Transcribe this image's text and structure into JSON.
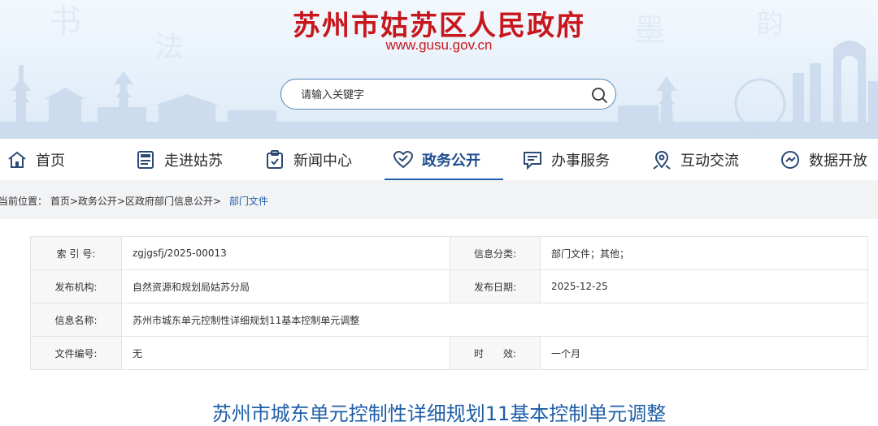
{
  "header": {
    "site_title": "苏州市姑苏区人民政府",
    "site_url": "www.gusu.gov.cn"
  },
  "search": {
    "placeholder": "请输入关键字",
    "icon": "search-icon"
  },
  "nav": {
    "items": [
      {
        "label": "首页",
        "icon": "home-icon",
        "active": false
      },
      {
        "label": "走进姑苏",
        "icon": "news-card-icon",
        "active": false
      },
      {
        "label": "新闻中心",
        "icon": "clipboard-icon",
        "active": false
      },
      {
        "label": "政务公开",
        "icon": "heart-icon",
        "active": true
      },
      {
        "label": "办事服务",
        "icon": "chat-icon",
        "active": false
      },
      {
        "label": "互动交流",
        "icon": "map-pin-icon",
        "active": false
      },
      {
        "label": "数据开放",
        "icon": "gauge-icon",
        "active": false
      }
    ]
  },
  "breadcrumb": {
    "prefix": "当前位置：",
    "items": [
      "首页",
      "政务公开",
      "区政府部门信息公开"
    ],
    "separator": ">",
    "current": "部门文件"
  },
  "info": {
    "index_label": "索 引 号:",
    "index_value": "zgjgsfj/2025-00013",
    "category_label": "信息分类:",
    "category_value": "部门文件；其他；",
    "publisher_label": "发布机构:",
    "publisher_value": "自然资源和规划局姑苏分局",
    "date_label": "发布日期:",
    "date_value": "2025-12-25",
    "name_label": "信息名称:",
    "name_value": "苏州市城东单元控制性详细规划11基本控制单元调整",
    "docno_label": "文件编号:",
    "docno_value": "无",
    "validity_label": "时　　效:",
    "validity_value": "一个月"
  },
  "document": {
    "title": "苏州市城东单元控制性详细规划11基本控制单元调整"
  },
  "colors": {
    "brand_red": "#c8161d",
    "accent_blue": "#1f5fa8"
  }
}
